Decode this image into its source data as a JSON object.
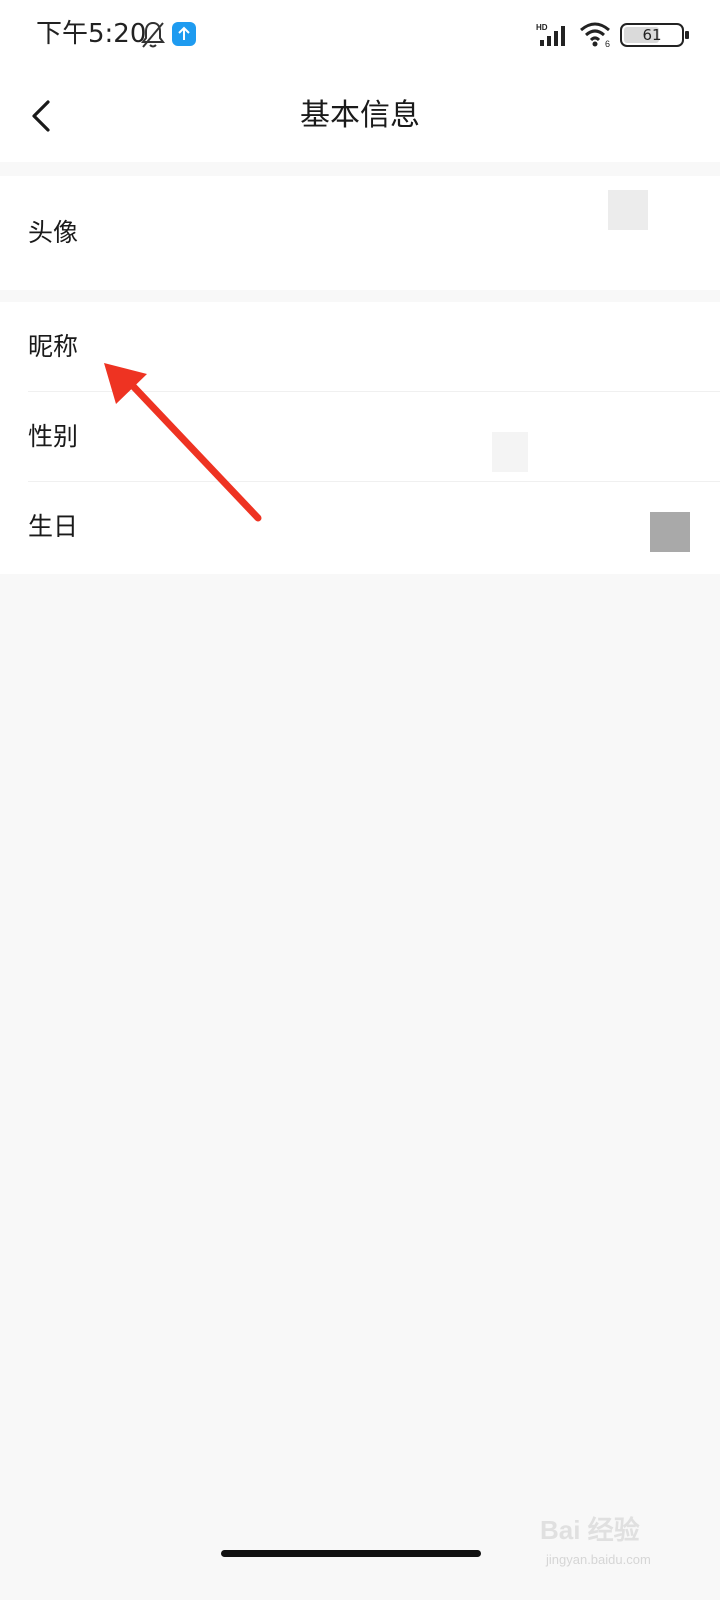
{
  "status_bar": {
    "time": "下午5:20",
    "battery": "61",
    "icons": [
      "mute-bell-icon",
      "upload-badge-icon",
      "hd-signal-icon",
      "wifi-icon",
      "battery-icon"
    ]
  },
  "header": {
    "title": "基本信息",
    "back_icon": "chevron-left-icon"
  },
  "profile_rows": [
    {
      "label": "头像"
    },
    {
      "label": "昵称"
    },
    {
      "label": "性别"
    },
    {
      "label": "生日"
    }
  ],
  "colors": {
    "page_background": "#f8f8f8",
    "card_background": "#ffffff",
    "annotation_arrow": "#ee3322",
    "upload_badge": "#1e9bf0"
  },
  "watermark": {
    "main": "Bai 经验",
    "sub": "jingyan.baidu.com"
  }
}
